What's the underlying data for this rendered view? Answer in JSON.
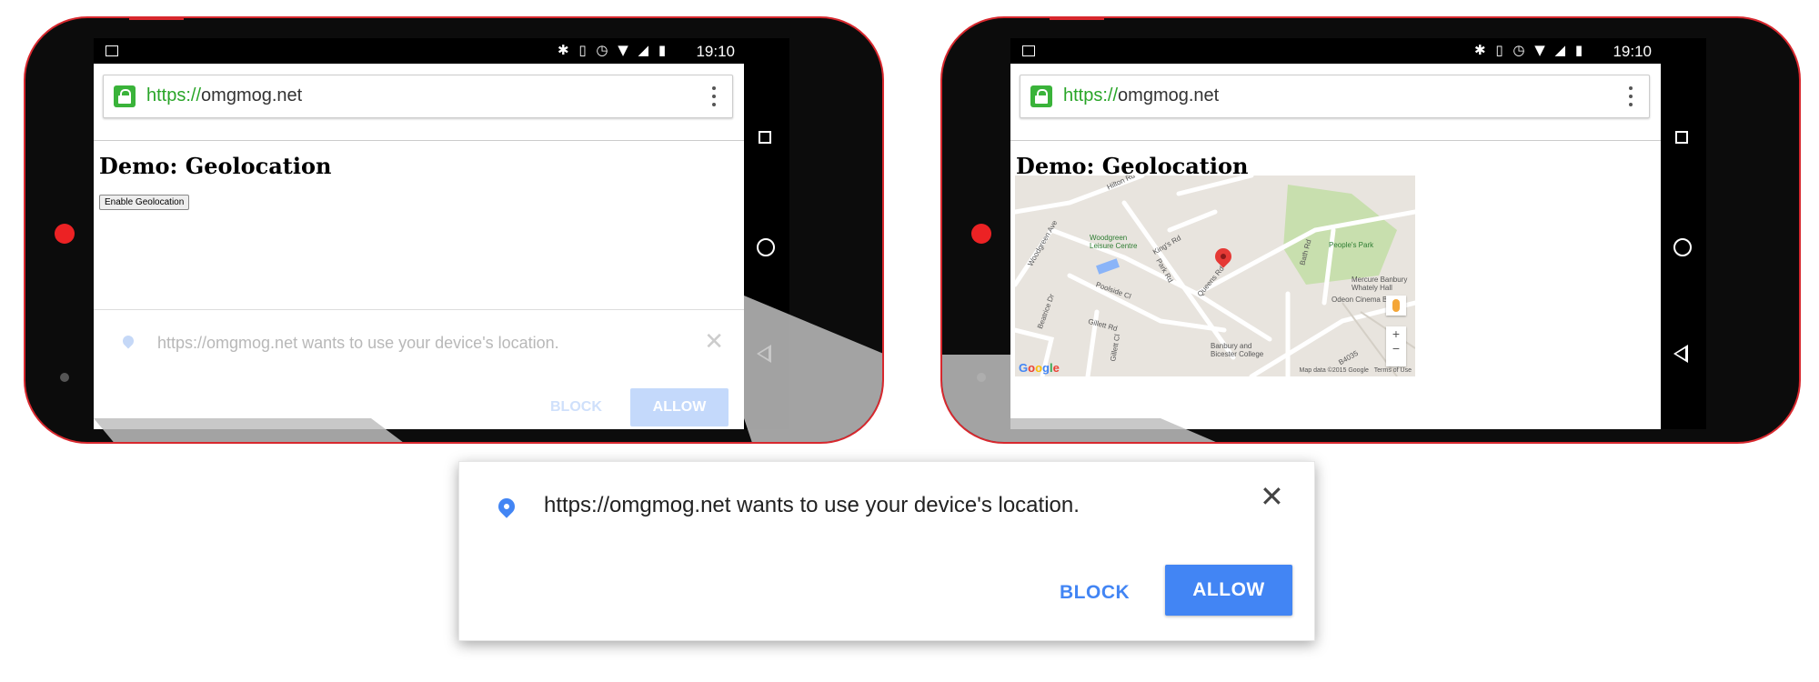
{
  "left_phone": {
    "status_time": "19:10",
    "status_icons": "✱ ▯ ◷ ▼ ◢ ▮",
    "url_scheme": "https://",
    "url_host": "omgmog.net",
    "page_title": "Demo: Geolocation",
    "enable_button": "Enable Geolocation",
    "prompt": {
      "message": "https://omgmog.net wants to use your device's location.",
      "block": "BLOCK",
      "allow": "ALLOW"
    }
  },
  "right_phone": {
    "status_time": "19:10",
    "status_icons": "✱ ▯ ◷ ▼ ◢ ▮",
    "url_scheme": "https://",
    "url_host": "omgmog.net",
    "page_title": "Demo: Geolocation",
    "map": {
      "labels": [
        "Hilton Rd",
        "Woodgreen Ave",
        "Woodgreen Leisure Centre",
        "King's Rd",
        "Park Rd",
        "Queens Rd",
        "Bath Rd",
        "People's Park",
        "Mercure Banbury Whately Hall",
        "Odeon Cinema Ba",
        "Poolside Cl",
        "Beatrice Dr",
        "Gillett Rd",
        "Gillett Cl",
        "Banbury and Bicester College",
        "B4035"
      ],
      "attribution": "Map data ©2015 Google",
      "terms": "Terms of Use",
      "logo": [
        "G",
        "o",
        "o",
        "g",
        "l",
        "e"
      ]
    }
  },
  "callout": {
    "message": "https://omgmog.net wants to use your device's location.",
    "block": "BLOCK",
    "allow": "ALLOW"
  },
  "colors": {
    "phone_frame": "#0c0c0c",
    "phone_border": "#d8282e",
    "camera": "#ec2224",
    "accent_blue": "#4285f4",
    "secure_green": "#29a528"
  }
}
